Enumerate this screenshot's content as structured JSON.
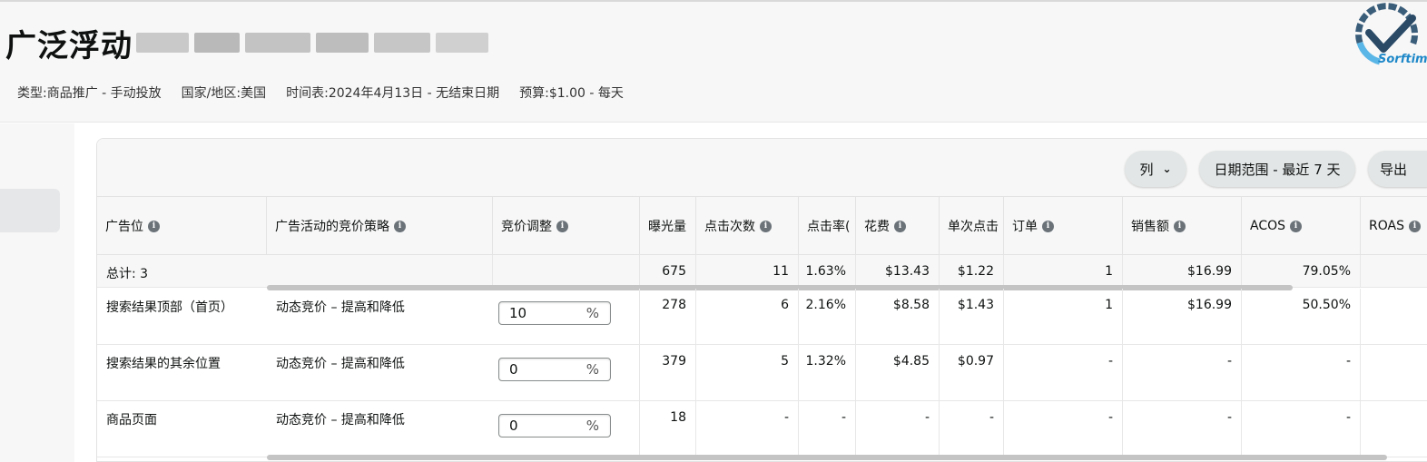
{
  "header": {
    "title": "广泛浮动",
    "meta": [
      "类型:商品推广 - 手动投放",
      "国家/地区:美国",
      "时间表:2024年4月13日 - 无结束日期",
      "预算:$1.00 - 每天"
    ],
    "logo_text": "Sorftim"
  },
  "toolbar": {
    "columns_label": "列",
    "date_range_label": "日期范围 - 最近 7 天",
    "export_label": "导出"
  },
  "table": {
    "columns": [
      "广告位",
      "广告活动的竞价策略",
      "竞价调整",
      "曝光量",
      "点击次数",
      "点击率(",
      "花费",
      "单次点击",
      "订单",
      "销售额",
      "ACOS",
      "ROAS"
    ],
    "total": {
      "label": "总计: 3",
      "impressions": "675",
      "clicks": "11",
      "ctr": "1.63%",
      "spend": "$13.43",
      "cpc": "$1.22",
      "orders": "1",
      "sales": "$16.99",
      "acos": "79.05%"
    },
    "rows": [
      {
        "placement": "搜索结果顶部（首页）",
        "strategy": "动态竞价 – 提高和降低",
        "bid": "10",
        "unit": "%",
        "impressions": "278",
        "clicks": "6",
        "ctr": "2.16%",
        "spend": "$8.58",
        "cpc": "$1.43",
        "orders": "1",
        "sales": "$16.99",
        "acos": "50.50%"
      },
      {
        "placement": "搜索结果的其余位置",
        "strategy": "动态竞价 – 提高和降低",
        "bid": "0",
        "unit": "%",
        "impressions": "379",
        "clicks": "5",
        "ctr": "1.32%",
        "spend": "$4.85",
        "cpc": "$0.97",
        "orders": "-",
        "sales": "-",
        "acos": "-"
      },
      {
        "placement": "商品页面",
        "strategy": "动态竞价 – 提高和降低",
        "bid": "0",
        "unit": "%",
        "impressions": "18",
        "clicks": "-",
        "ctr": "-",
        "spend": "-",
        "cpc": "-",
        "orders": "-",
        "sales": "-",
        "acos": "-"
      }
    ]
  },
  "colors": {
    "header_bg": "#f7f7f7",
    "pill_bg": "#e3e6e6",
    "info_icon": "#6b7379",
    "logo_blue": "#1e88c8"
  }
}
